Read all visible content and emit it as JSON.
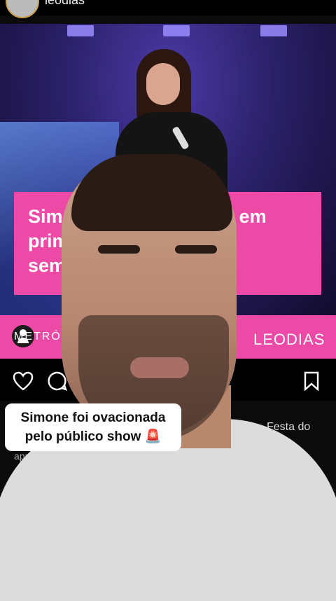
{
  "header": {
    "username": "leodias",
    "more_label": "•••"
  },
  "post": {
    "headline": "Simone foi ovacionada em\nprimeira apresentação\nsem Simaria",
    "source_left": "METRÓPOLES",
    "brand": "LEODIAS"
  },
  "actions": [
    "heart-icon",
    "comment-icon",
    "bookmark-icon"
  ],
  "caption": {
    "line1": "Simone foi ovacionada",
    "line2": "pelo público show 🚨"
  },
  "feed_text": {
    "right": "Festa do",
    "left": "apro"
  }
}
